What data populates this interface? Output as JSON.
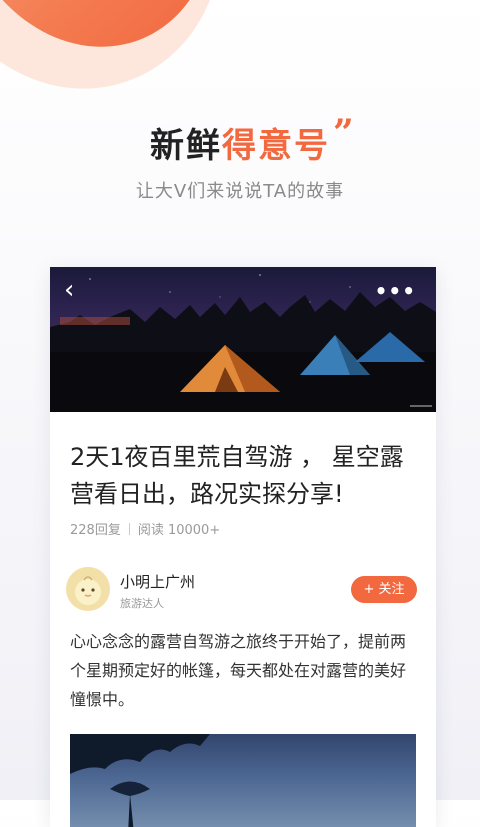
{
  "hero": {
    "title_prefix": "新鲜",
    "title_accent": "得意号",
    "quote_mark": "”",
    "subtitle": "让大V们来说说TA的故事"
  },
  "card": {
    "back_icon": "‹",
    "more_icon": "•••",
    "article_title": "2天1夜百里荒自驾游 ， 星空露营看日出，路况实探分享!",
    "replies": "228回复",
    "reads": "阅读 10000+",
    "author": {
      "name": "小明上广州",
      "tag": "旅游达人"
    },
    "follow_label": "+ 关注",
    "body": "心心念念的露营自驾游之旅终于开始了，提前两个星期预定好的帐篷，每天都处在对露营的美好憧憬中。"
  },
  "colors": {
    "accent": "#f2683f",
    "title": "#222222",
    "subtitle": "#8a8a8a"
  }
}
